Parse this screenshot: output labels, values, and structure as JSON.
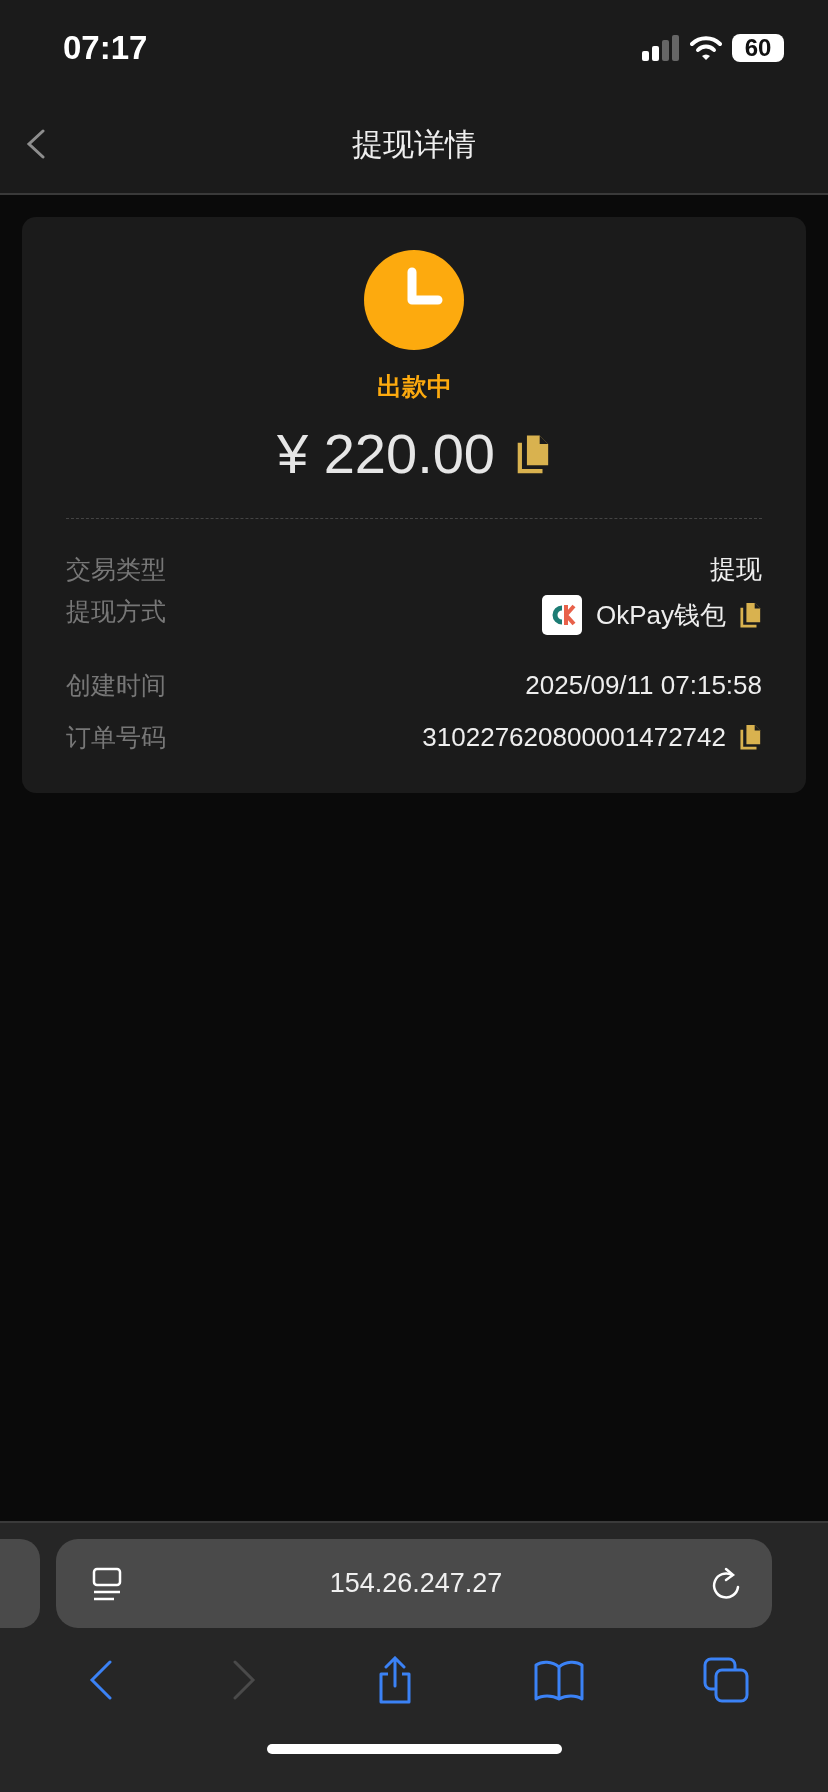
{
  "status_bar": {
    "time": "07:17",
    "battery": "60"
  },
  "nav": {
    "title": "提现详情"
  },
  "card": {
    "status": "出款中",
    "amount": "¥ 220.00",
    "rows": [
      {
        "label": "交易类型",
        "value": "提现",
        "kind": "text"
      },
      {
        "label": "提现方式",
        "value": "OkPay钱包",
        "kind": "wallet"
      },
      {
        "label": "创建时间",
        "value": "2025/09/11 07:15:58",
        "kind": "text"
      },
      {
        "label": "订单号码",
        "value": "310227620800001472742",
        "kind": "copy"
      }
    ]
  },
  "browser": {
    "url": "154.26.247.27",
    "forward_disabled": true
  }
}
